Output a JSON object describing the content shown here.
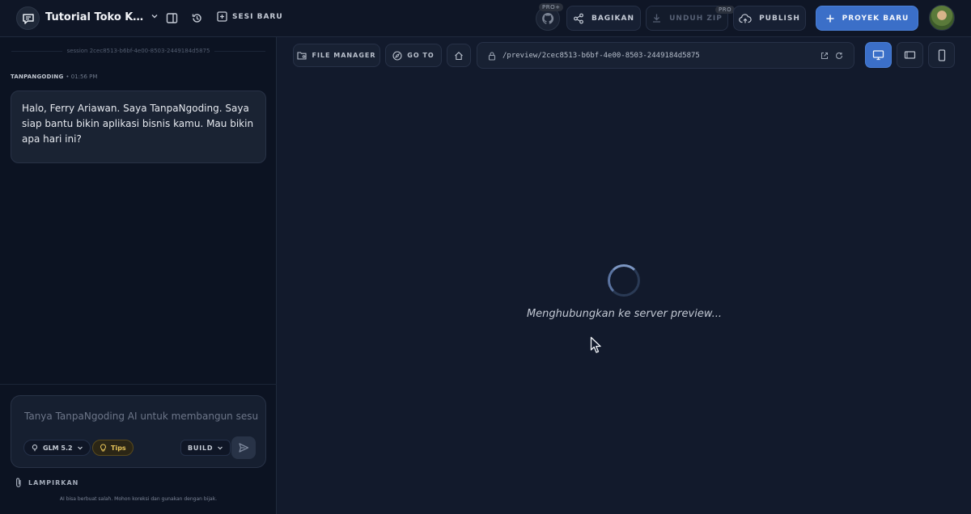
{
  "header": {
    "project_title": "Tutorial Toko Kue Online",
    "new_session_label": "SESI BARU",
    "github_badge": "PRO+",
    "share_label": "BAGIKAN",
    "download_label": "UNDUH ZIP",
    "download_badge": "PRO",
    "publish_label": "PUBLISH",
    "new_project_label": "PROYEK BARU"
  },
  "chat": {
    "session_id": "session 2cec8513-b6bf-4e00-8503-2449184d5875",
    "messages": [
      {
        "sender": "TANPANGODING",
        "time": "• 01:56 PM",
        "text": "Halo, Ferry Ariawan. Saya TanpaNgoding. Saya siap bantu bikin aplikasi bisnis kamu. Mau bikin apa hari ini?"
      }
    ],
    "composer": {
      "placeholder": "Tanya TanpaNgoding AI untuk membangun sesuatu...",
      "model": "GLM 5.2",
      "tips": "Tips",
      "mode": "BUILD"
    },
    "attach_label": "LAMPIRKAN",
    "disclaimer": "AI bisa berbuat salah. Mohon koreksi dan gunakan dengan bijak."
  },
  "preview": {
    "file_manager_label": "FILE MANAGER",
    "goto_label": "GO TO",
    "url": "/preview/2cec8513-b6bf-4e00-8503-2449184d5875",
    "loading_text": "Menghubungkan ke server preview..."
  },
  "colors": {
    "accent": "#3b6fc8",
    "background": "#121a2c",
    "panel": "#0c1322",
    "tips": "#e6c45a"
  }
}
